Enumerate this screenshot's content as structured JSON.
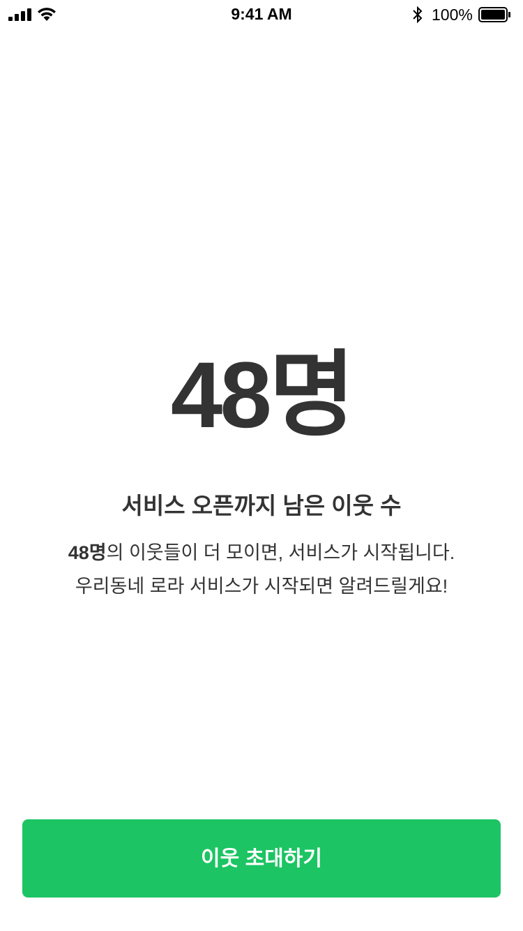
{
  "status_bar": {
    "time": "9:41 AM",
    "battery_percent": "100%",
    "battery_level": 1.0,
    "icons": [
      "cellular-signal-icon",
      "wifi-icon",
      "bluetooth-icon",
      "battery-icon"
    ]
  },
  "main": {
    "count_number": "48",
    "count_unit": "명",
    "headline": "서비스 오픈까지 남은 이웃 수",
    "description": {
      "line1_bold": "48명",
      "line1_rest": "의 이웃들이 더 모이면, 서비스가 시작됩니다.",
      "line2": "우리동네 로라 서비스가 시작되면 알려드릴게요!"
    }
  },
  "cta": {
    "label": "이웃 초대하기"
  },
  "colors": {
    "accent": "#1cc463",
    "text": "#333333",
    "background": "#ffffff"
  }
}
